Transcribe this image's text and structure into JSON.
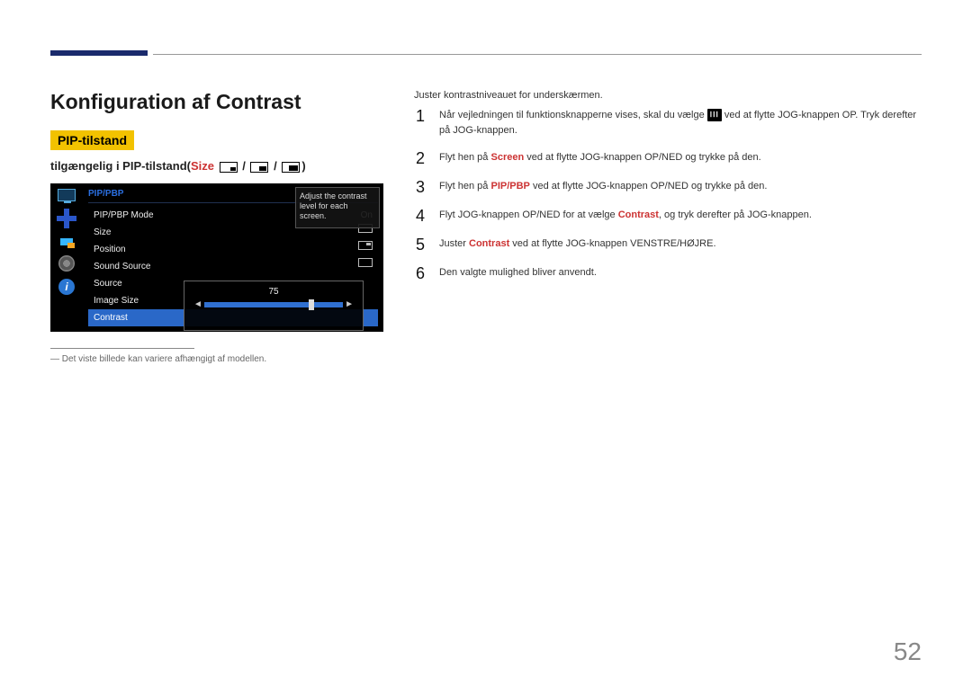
{
  "page_number": "52",
  "title": "Konfiguration af Contrast",
  "mode_badge": "PIP-tilstand",
  "subhead_prefix": "tilgængelig i PIP-tilstand(",
  "subhead_size": "Size",
  "subhead_sep": " / ",
  "subhead_suffix": ")",
  "note": "Det viste billede kan variere afhængigt af modellen.",
  "osd": {
    "title": "PIP/PBP",
    "tip": "Adjust the contrast level for each screen.",
    "items": [
      {
        "label": "PIP/PBP Mode",
        "value": "On",
        "vtype": "text"
      },
      {
        "label": "Size",
        "value": "",
        "vtype": "icon-size"
      },
      {
        "label": "Position",
        "value": "",
        "vtype": "icon-pos"
      },
      {
        "label": "Sound Source",
        "value": "",
        "vtype": "icon-size"
      },
      {
        "label": "Source",
        "value": "",
        "vtype": ""
      },
      {
        "label": "Image Size",
        "value": "",
        "vtype": ""
      },
      {
        "label": "Contrast",
        "value": "",
        "vtype": "",
        "selected": true
      }
    ],
    "slider_value": "75"
  },
  "intro": "Juster kontrastniveauet for underskærmen.",
  "steps": {
    "s1a": "Når vejledningen til funktionsknapperne vises, skal du vælge ",
    "s1b": " ved at flytte JOG-knappen OP. Tryk derefter på JOG-knappen.",
    "s2a": "Flyt hen på ",
    "s2screen": "Screen",
    "s2b": " ved at flytte JOG-knappen OP/NED og trykke på den.",
    "s3a": "Flyt hen på ",
    "s3pip": "PIP/PBP",
    "s3b": " ved at flytte JOG-knappen OP/NED og trykke på den.",
    "s4a": "Flyt JOG-knappen OP/NED for at vælge ",
    "s4c": "Contrast",
    "s4b": ", og tryk derefter på JOG-knappen.",
    "s5a": "Juster ",
    "s5c": "Contrast",
    "s5b": " ved at flytte JOG-knappen VENSTRE/HØJRE.",
    "s6": "Den valgte mulighed bliver anvendt."
  },
  "nums": {
    "n1": "1",
    "n2": "2",
    "n3": "3",
    "n4": "4",
    "n5": "5",
    "n6": "6"
  }
}
